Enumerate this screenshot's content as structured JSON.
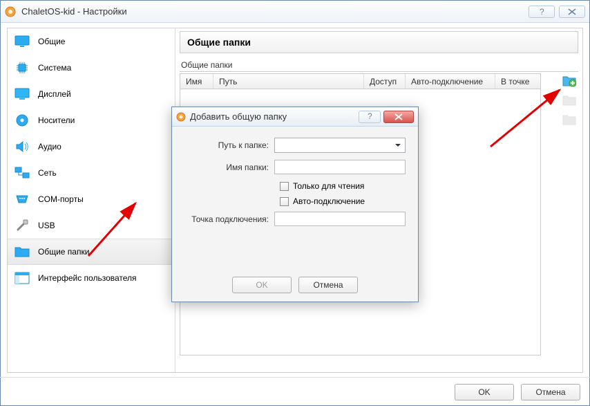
{
  "window": {
    "title": "ChaletOS-kid - Настройки"
  },
  "sidebar": {
    "items": [
      {
        "label": "Общие"
      },
      {
        "label": "Система"
      },
      {
        "label": "Дисплей"
      },
      {
        "label": "Носители"
      },
      {
        "label": "Аудио"
      },
      {
        "label": "Сеть"
      },
      {
        "label": "COM-порты"
      },
      {
        "label": "USB"
      },
      {
        "label": "Общие папки"
      },
      {
        "label": "Интерфейс пользователя"
      }
    ]
  },
  "main": {
    "panel_title": "Общие папки",
    "group_label": "Общие папки",
    "columns": {
      "name": "Имя",
      "path": "Путь",
      "access": "Доступ",
      "automount": "Авто-подключение",
      "mountpoint": "В точке"
    }
  },
  "dialog": {
    "title": "Добавить общую папку",
    "labels": {
      "path": "Путь к папке:",
      "name": "Имя папки:",
      "readonly": "Только для чтения",
      "automount": "Авто-подключение",
      "mountpoint": "Точка подключения:"
    },
    "values": {
      "path": "",
      "name": "",
      "mountpoint": ""
    },
    "buttons": {
      "ok": "OK",
      "cancel": "Отмена"
    }
  },
  "buttons": {
    "ok": "OK",
    "cancel": "Отмена"
  }
}
